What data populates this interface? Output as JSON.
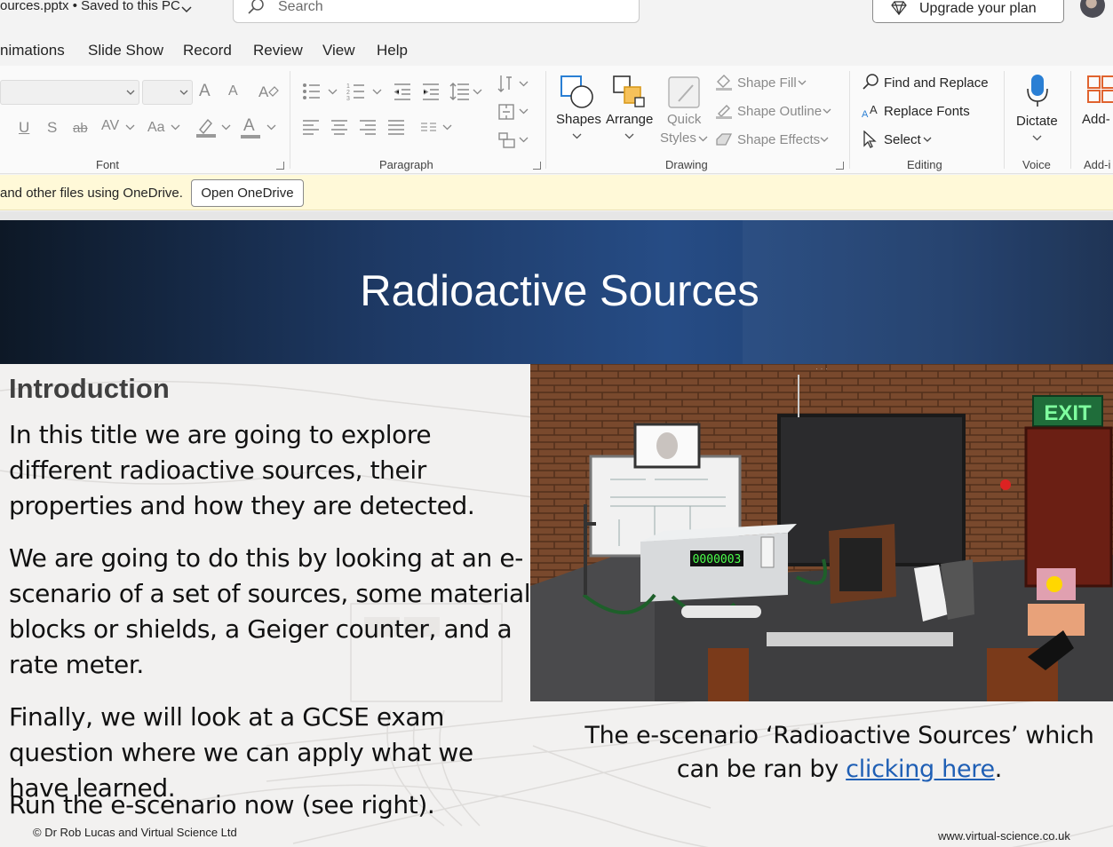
{
  "titlebar": {
    "filename": "ources.pptx  •  Saved to this PC",
    "search_placeholder": "Search",
    "upgrade_label": "Upgrade your plan"
  },
  "tabs": [
    "nimations",
    "Slide Show",
    "Record",
    "Review",
    "View",
    "Help"
  ],
  "ribbon": {
    "groups": {
      "font": "Font",
      "paragraph": "Paragraph",
      "drawing": "Drawing",
      "editing": "Editing",
      "voice": "Voice",
      "addins": "Add-i"
    },
    "drawing": {
      "shapes": "Shapes",
      "arrange": "Arrange",
      "quick_styles_1": "Quick",
      "quick_styles_2": "Styles",
      "shape_fill": "Shape Fill",
      "shape_outline": "Shape Outline",
      "shape_effects": "Shape Effects"
    },
    "editing": {
      "find_replace": "Find and Replace",
      "replace_fonts": "Replace Fonts",
      "select": "Select"
    },
    "voice": {
      "dictate": "Dictate"
    },
    "addins": {
      "label": "Add-"
    },
    "font_controls": {
      "underline": "U",
      "strike": "S",
      "strikethrough": "ab",
      "spacing": "AV",
      "case": "Aa",
      "grow": "A",
      "shrink": "A",
      "color_a": "A"
    }
  },
  "infobar": {
    "message": "and other files using OneDrive.",
    "button": "Open OneDrive"
  },
  "slide": {
    "title": "Radioactive Sources",
    "heading": "Introduction",
    "paragraphs": [
      "In this title we are going to explore different radioactive sources, their properties and how they are detected.",
      "We are going to do this by looking at an e-scenario of a set of sources, some material blocks or shields, a Geiger counter, and a rate meter.",
      "Finally, we will look at a GCSE exam question where we can apply what we have learned.",
      "Run the e-scenario now (see right)."
    ],
    "scene": {
      "exit_sign": "EXIT",
      "counter_display": "0000003"
    },
    "caption_before": "The e-scenario ‘Radioactive Sources’ which can be ran by ",
    "caption_link": "clicking here",
    "caption_after": ".",
    "copyright": "© Dr Rob Lucas and Virtual Science Ltd",
    "website": "www.virtual-science.co.uk"
  },
  "colors": {
    "banner": "#1e3a66",
    "link": "#1f5fb5",
    "infobar": "#fff9d8",
    "dictate_blue": "#2a7fd4"
  }
}
